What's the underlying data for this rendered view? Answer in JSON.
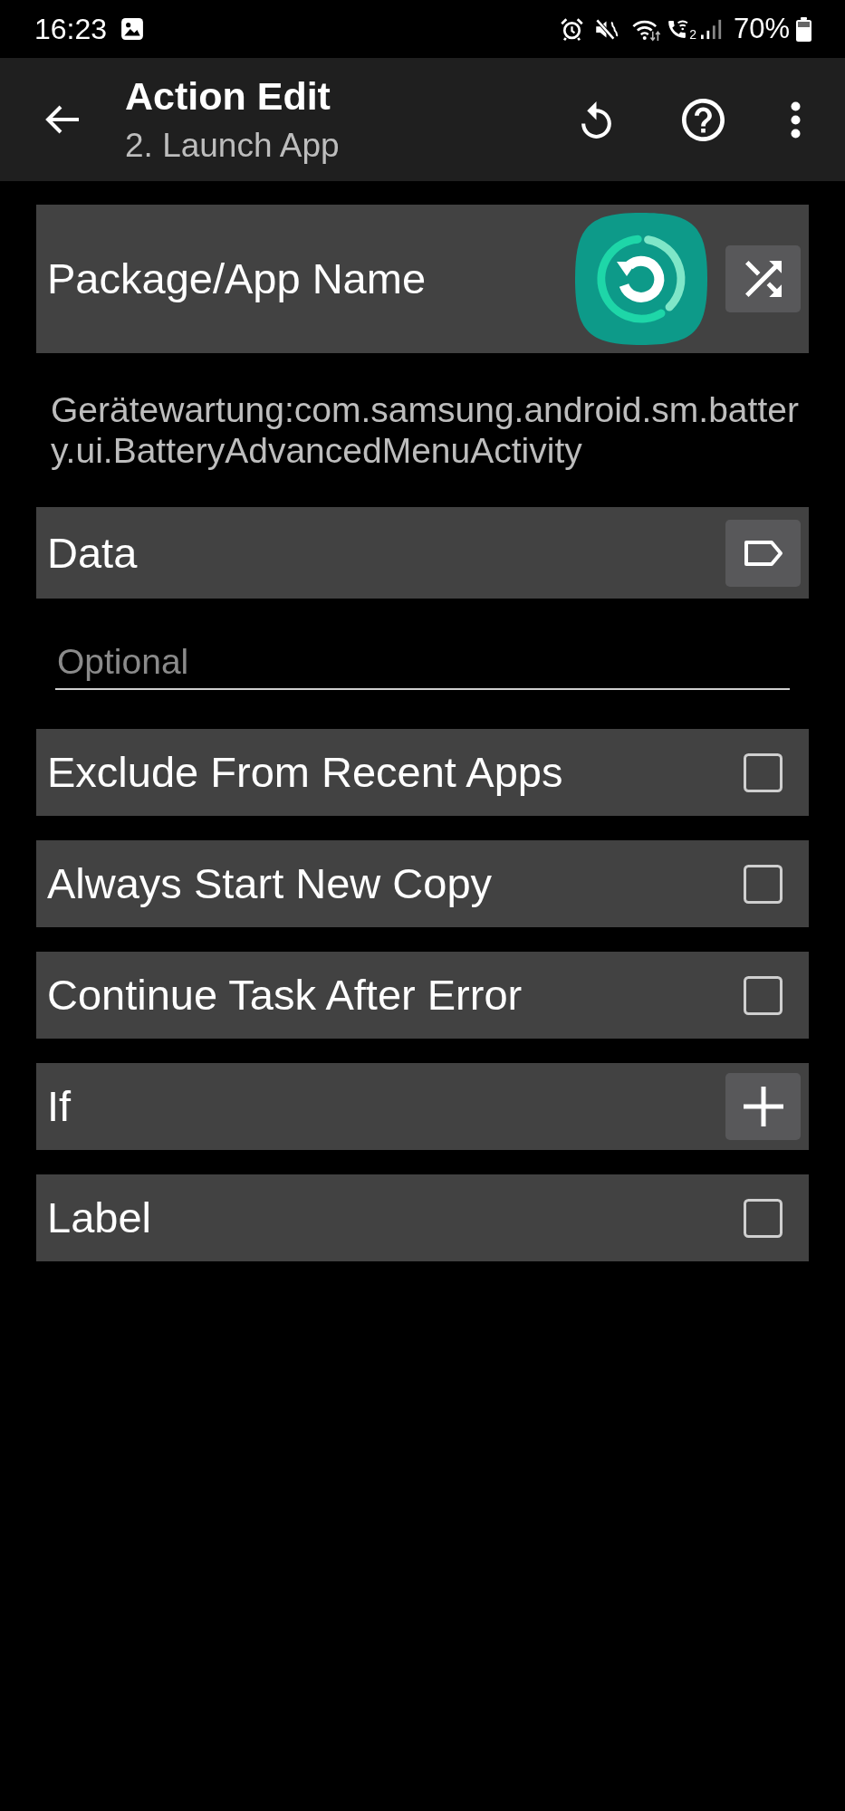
{
  "status_bar": {
    "time": "16:23",
    "sim": "2",
    "battery": "70%"
  },
  "toolbar": {
    "title": "Action Edit",
    "subtitle": "2. Launch App"
  },
  "package": {
    "label": "Package/App Name",
    "value": "Gerätewartung:com.samsung.android.sm.battery.ui.BatteryAdvancedMenuActivity"
  },
  "data": {
    "label": "Data",
    "placeholder": "Optional"
  },
  "options": [
    {
      "kind": "checkbox",
      "label": "Exclude From Recent Apps",
      "checked": false
    },
    {
      "kind": "checkbox",
      "label": "Always Start New Copy",
      "checked": false
    },
    {
      "kind": "checkbox",
      "label": "Continue Task After Error",
      "checked": false
    },
    {
      "kind": "add",
      "label": "If"
    },
    {
      "kind": "checkbox",
      "label": "Label",
      "checked": false
    }
  ]
}
